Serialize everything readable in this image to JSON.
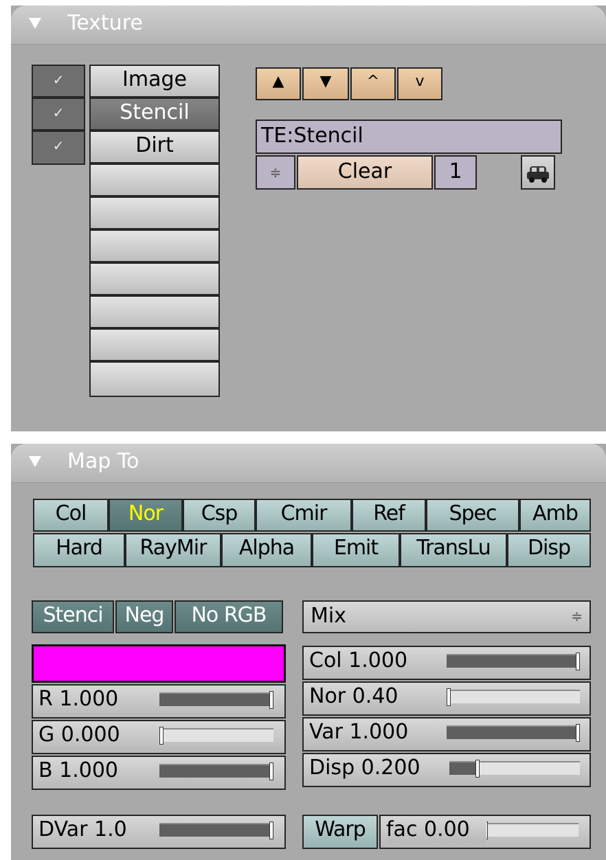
{
  "texture_panel": {
    "title": "Texture",
    "channels": [
      {
        "label": "Image",
        "checked": true,
        "active": false
      },
      {
        "label": "Stencil",
        "checked": true,
        "active": true
      },
      {
        "label": "Dirt",
        "checked": true,
        "active": false
      },
      {
        "label": "",
        "checked": false,
        "active": false
      },
      {
        "label": "",
        "checked": false,
        "active": false
      },
      {
        "label": "",
        "checked": false,
        "active": false
      },
      {
        "label": "",
        "checked": false,
        "active": false
      },
      {
        "label": "",
        "checked": false,
        "active": false
      },
      {
        "label": "",
        "checked": false,
        "active": false
      },
      {
        "label": "",
        "checked": false,
        "active": false
      }
    ],
    "check_glyph": "✓",
    "arrows": {
      "copy": "▲",
      "paste": "▼",
      "up": "^",
      "down": "v"
    },
    "texture_name": "TE:Stencil",
    "browse_glyph": "≑",
    "clear_label": "Clear",
    "users_count": "1",
    "fake_user_icon": "car-icon"
  },
  "mapto_panel": {
    "title": "Map To",
    "row1": [
      {
        "label": "Col",
        "on": false
      },
      {
        "label": "Nor",
        "on": true
      },
      {
        "label": "Csp",
        "on": false
      },
      {
        "label": "Cmir",
        "on": false
      },
      {
        "label": "Ref",
        "on": false
      },
      {
        "label": "Spec",
        "on": false
      },
      {
        "label": "Amb",
        "on": false
      }
    ],
    "row2": [
      {
        "label": "Hard",
        "on": false
      },
      {
        "label": "RayMir",
        "on": false
      },
      {
        "label": "Alpha",
        "on": false
      },
      {
        "label": "Emit",
        "on": false
      },
      {
        "label": "TransLu",
        "on": false
      },
      {
        "label": "Disp",
        "on": false
      }
    ],
    "stencil_label": "Stenci",
    "neg_label": "Neg",
    "norgb_label": "No RGB",
    "blend_mode": "Mix",
    "blend_glyph": "≑",
    "swatch_color": "#ff00ff",
    "r": {
      "label": "R 1.000",
      "value": 1.0
    },
    "g": {
      "label": "G 0.000",
      "value": 0.0
    },
    "b": {
      "label": "B 1.000",
      "value": 1.0
    },
    "dvar": {
      "label": "DVar 1.0",
      "value": 1.0
    },
    "col": {
      "label": "Col 1.000",
      "value": 1.0
    },
    "nor": {
      "label": "Nor 0.40",
      "value": 0.0
    },
    "var": {
      "label": "Var 1.000",
      "value": 1.0
    },
    "disp": {
      "label": "Disp 0.200",
      "value": 0.2
    },
    "warp_label": "Warp",
    "fac": {
      "label": "fac 0.00",
      "value": 0.0
    }
  }
}
